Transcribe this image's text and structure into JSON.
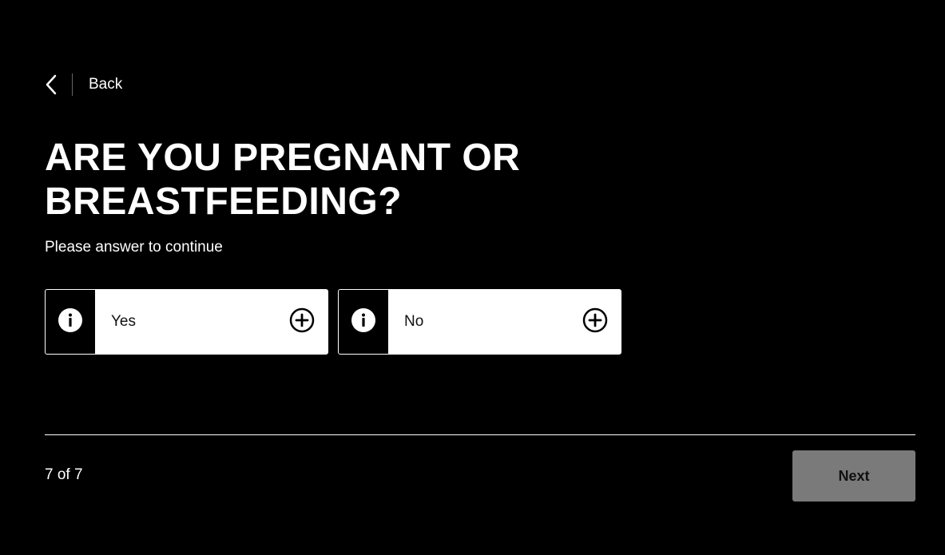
{
  "nav": {
    "back_label": "Back",
    "back_icon": "chevron-left-icon"
  },
  "question": {
    "title": "ARE YOU PREGNANT OR BREASTFEEDING?",
    "subtitle": "Please answer to continue"
  },
  "options": [
    {
      "label": "Yes",
      "info_icon": "info-icon",
      "action_icon": "plus-circle-icon"
    },
    {
      "label": "No",
      "info_icon": "info-icon",
      "action_icon": "plus-circle-icon"
    }
  ],
  "footer": {
    "progress_text": "7 of 7",
    "next_label": "Next"
  },
  "colors": {
    "background": "#000000",
    "text": "#ffffff",
    "option_bg": "#ffffff",
    "next_disabled_bg": "#7a7a7a"
  }
}
